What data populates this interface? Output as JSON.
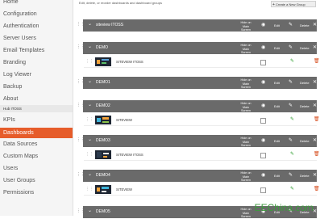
{
  "sidebar": {
    "items": [
      {
        "label": "Home"
      },
      {
        "label": "Configuration"
      },
      {
        "label": "Authentication"
      },
      {
        "label": "Server Users"
      },
      {
        "label": "Email Templates"
      },
      {
        "label": "Branding"
      },
      {
        "label": "Log Viewer"
      },
      {
        "label": "Backup"
      },
      {
        "label": "About"
      }
    ],
    "section_label": "Hub ITOSS",
    "section_items": [
      {
        "label": "KPIs"
      },
      {
        "label": "Dashboards"
      },
      {
        "label": "Data Sources"
      },
      {
        "label": "Custom Maps"
      },
      {
        "label": "Users"
      },
      {
        "label": "User Groups"
      },
      {
        "label": "Permissions"
      }
    ],
    "active": "Dashboards"
  },
  "header": {
    "description": "Edit, delete, or reorder dashboards and dashboard groups",
    "new_group_label": "Create a New Group"
  },
  "columns": {
    "hide_on_main": "Hide on Main Screen",
    "edit": "Edit",
    "delete": "Delete"
  },
  "groups": [
    {
      "name": "siteview ITOSS",
      "dashboards": []
    },
    {
      "name": "DEMO",
      "dashboards": [
        {
          "name": "SITEVIEW ITOSS"
        }
      ]
    },
    {
      "name": "DEMO1",
      "dashboards": []
    },
    {
      "name": "DEMO2",
      "dashboards": [
        {
          "name": "SITEVIEW"
        }
      ]
    },
    {
      "name": "DEMO3",
      "dashboards": [
        {
          "name": "SITEVIEW ITOSS"
        }
      ]
    },
    {
      "name": "DEMO4",
      "dashboards": [
        {
          "name": "SITEVIEW"
        }
      ]
    },
    {
      "name": "DEMO5",
      "dashboards": []
    }
  ],
  "watermark": "EEChina.com",
  "colors": {
    "accent": "#e65c2a",
    "group_bar": "#6a6a6a",
    "edit_icon": "#2e9e2e",
    "delete_icon": "#d64a1a"
  }
}
